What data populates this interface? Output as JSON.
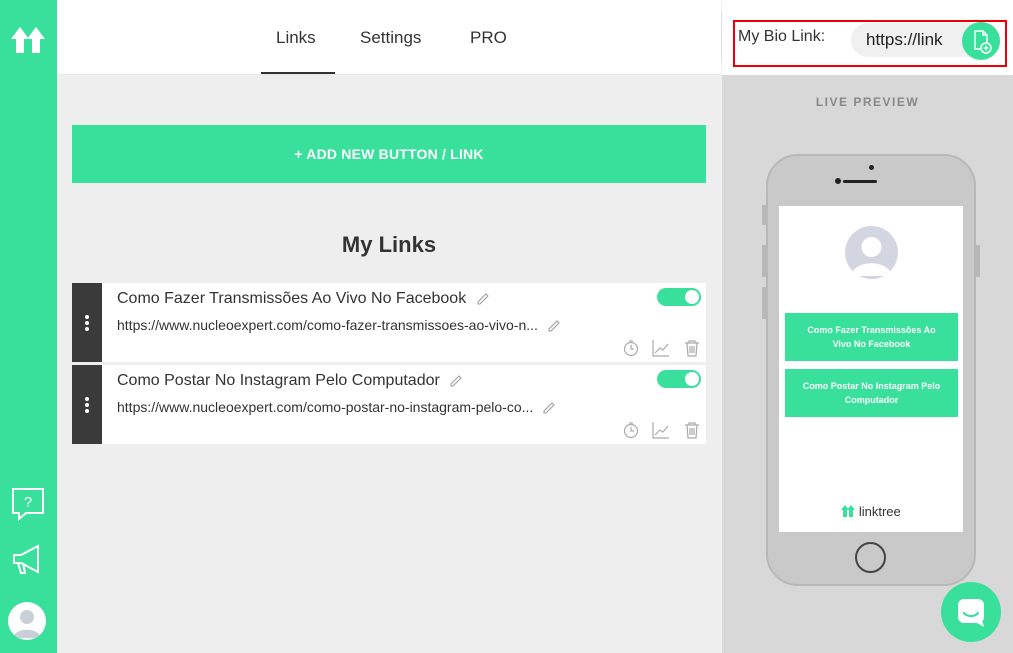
{
  "nav": {
    "tabs": [
      {
        "label": "Links",
        "active": true
      },
      {
        "label": "Settings",
        "active": false
      },
      {
        "label": "PRO",
        "active": false
      }
    ]
  },
  "header": {
    "bio_label": "My Bio Link:",
    "bio_url": "https://link"
  },
  "main": {
    "add_button_label": "+ ADD NEW BUTTON / LINK",
    "section_title": "My Links",
    "links": [
      {
        "title": "Como Fazer Transmissões Ao Vivo No Facebook",
        "url": "https://www.nucleoexpert.com/como-fazer-transmissoes-ao-vivo-n...",
        "enabled": true
      },
      {
        "title": "Como Postar No Instagram Pelo Computador",
        "url": "https://www.nucleoexpert.com/como-postar-no-instagram-pelo-co...",
        "enabled": true
      }
    ]
  },
  "preview": {
    "heading": "LIVE PREVIEW",
    "buttons": [
      "Como Fazer Transmissões Ao Vivo No Facebook",
      "Como Postar No Instagram Pelo Computador"
    ],
    "footer": "linktree"
  },
  "colors": {
    "brand_green": "#39e09b",
    "drag_handle": "#3a3a3a",
    "highlight_border": "#ee0000"
  },
  "icons": {
    "sidebar": [
      "linktree-logo-icon",
      "help-icon",
      "megaphone-icon",
      "user-avatar-icon"
    ],
    "card": [
      "pencil-icon",
      "timer-icon",
      "analytics-icon",
      "trash-icon"
    ],
    "header": [
      "copy-link-icon"
    ],
    "floating": [
      "chat-icon"
    ]
  }
}
